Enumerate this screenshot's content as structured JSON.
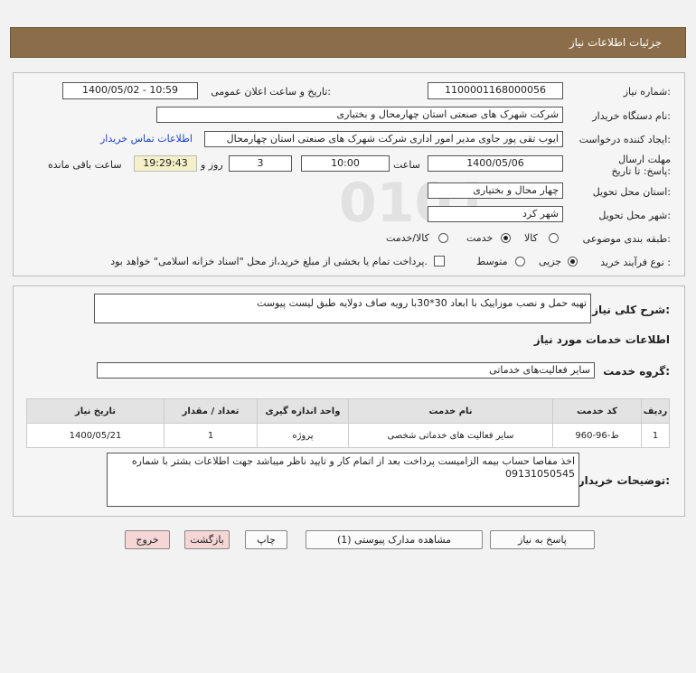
{
  "header": {
    "title": "جزئیات اطلاعات نیاز"
  },
  "form": {
    "need_number_label": "شماره نیاز:",
    "need_number": "1100001168000056",
    "announce_label": "تاریخ و ساعت اعلان عمومی:",
    "announce_value": "1400/05/02 - 10:59",
    "buyer_org_label": "نام دستگاه خریدار:",
    "buyer_org": "شرکت شهرک های صنعتی استان چهارمحال و بختیاری",
    "creator_label": "ایجاد کننده درخواست:",
    "creator": "ایوب تقی پور جاوی مدیر امور اداری شرکت شهرک های صنعتی استان چهارمحال",
    "contact_link": "اطلاعات تماس خریدار",
    "deadline_label": "مهلت ارسال پاسخ: تا تاریخ:",
    "deadline_date": "1400/05/06",
    "time_label": "ساعت",
    "deadline_time": "10:00",
    "days_value": "3",
    "days_label": "روز و",
    "remaining_time": "19:29:43",
    "remaining_label": "ساعت باقی مانده",
    "province_label": "استان محل تحویل:",
    "province": "چهار محال و بختیاری",
    "city_label": "شهر محل تحویل:",
    "city": "شهر کرد",
    "category_label": "طبقه بندی موضوعی:",
    "category_options": [
      "کالا",
      "خدمت",
      "کالا/خدمت"
    ],
    "category_selected": "خدمت",
    "purchase_type_label": "نوع فرآیند خرید :",
    "purchase_options": [
      "جزیی",
      "متوسط"
    ],
    "purchase_selected": "جزیی",
    "treasury_note": "پرداخت تمام یا بخشی از مبلغ خرید،از محل \"اسناد خزانه اسلامی\" خواهد بود."
  },
  "summary": {
    "label": "شرح کلی نیاز:",
    "text": "تهیه حمل و نصب موزاییک با ابعاد 30*30با رویه صاف دولایه طبق لیست پیوست"
  },
  "services": {
    "section_title": "اطلاعات خدمات مورد نیاز",
    "group_label": "گروه خدمت:",
    "group_value": "سایر فعالیت‌های خدماتی",
    "columns": [
      "ردیف",
      "کد خدمت",
      "نام خدمت",
      "واحد اندازه گیری",
      "تعداد / مقدار",
      "تاریخ نیاز"
    ],
    "rows": [
      [
        "1",
        "ط-96-960",
        "سایر فعالیت های خدماتی شخصی",
        "پروژه",
        "1",
        "1400/05/21"
      ]
    ]
  },
  "buyer_notes": {
    "label": "توضیحات خریدار:",
    "text": "اخذ مفاصا حساب بیمه الزامیست پرداخت بعد از اتمام کار و تایید ناظر میباشد جهت اطلاعات بشتر با شماره 09131050545"
  },
  "buttons": {
    "reply": "پاسخ به نیاز",
    "view_docs": "مشاهده مدارک پیوستی (1)",
    "print": "چاپ",
    "back": "بازگشت",
    "exit": "خروج"
  },
  "colors": {
    "header_bg": "#8c6d4a",
    "link": "#1a44c8",
    "danger_btn": "#f6d5d5"
  }
}
